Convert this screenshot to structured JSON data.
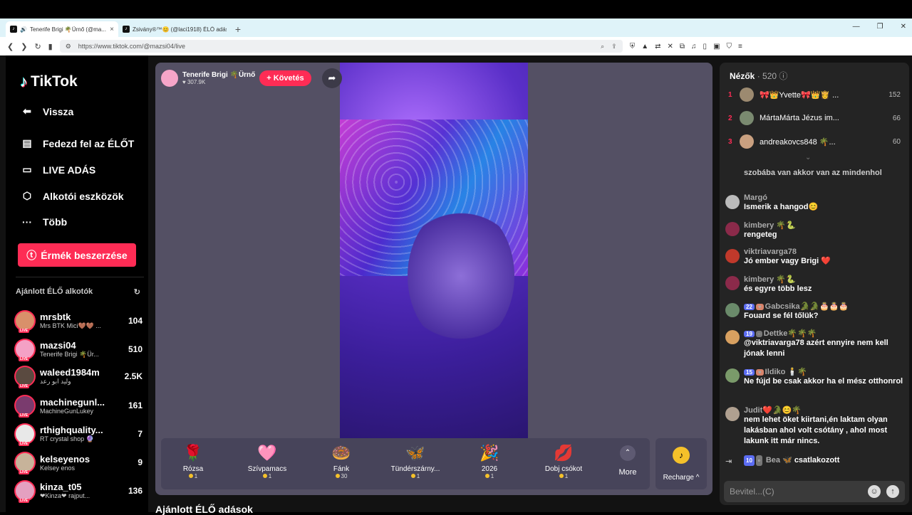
{
  "browser": {
    "tabs": [
      {
        "title": "Tenerife Brigi 🌴Ürnő (@ma..."
      },
      {
        "title": "Zsivány®™😊 (@laci1918) ÉLŐ adás..."
      }
    ],
    "url": "https://www.tiktok.com/@mazsi04/live"
  },
  "sidebar": {
    "logo": "TikTok",
    "nav": [
      {
        "label": "Vissza",
        "icon": "back-icon"
      },
      {
        "label": "Fedezd fel az ÉLŐT",
        "icon": "explore-live-icon"
      },
      {
        "label": "LIVE ADÁS",
        "icon": "live-camera-icon"
      },
      {
        "label": "Alkotói eszközök",
        "icon": "creator-tools-icon"
      },
      {
        "label": "Több",
        "icon": "more-dots-icon"
      }
    ],
    "coins_button": "Érmék beszerzése",
    "recommended_title": "Ajánlott ÉLŐ alkotók",
    "creators": [
      {
        "name": "mrsbtk",
        "sub": "Mrs BTK Mici🤎🤎 ...",
        "count": "104",
        "color": "#d9906a"
      },
      {
        "name": "mazsi04",
        "sub": "Tenerife Brigi 🌴Ür...",
        "count": "510",
        "color": "#f4a1c5"
      },
      {
        "name": "waleed1984m",
        "sub": "وليد ابو رعد",
        "count": "2.5K",
        "color": "#5a4a40"
      },
      {
        "name": "machinegunl...",
        "sub": "MachineGunLukey",
        "count": "161",
        "color": "#7a3b6e"
      },
      {
        "name": "rthighquality...",
        "sub": "RT crystal shop 🔮",
        "count": "7",
        "color": "#e8e8e8"
      },
      {
        "name": "kelseyenos",
        "sub": "Kelsey enos",
        "count": "9",
        "color": "#c7b39a"
      },
      {
        "name": "kinza_t05",
        "sub": "❤Kinza❤ rajput...",
        "count": "136",
        "color": "#e4a0c0"
      }
    ]
  },
  "stage": {
    "owner_name": "Tenerife Brigi 🌴Ürnő",
    "owner_likes": "307.9K",
    "follow_label": "+ Követés",
    "gifts": [
      {
        "name": "Rózsa",
        "price": "1",
        "icon": "🌹"
      },
      {
        "name": "Szívpamacs",
        "price": "1",
        "icon": "🩷"
      },
      {
        "name": "Fánk",
        "price": "30",
        "icon": "🍩"
      },
      {
        "name": "Tündérszárny...",
        "price": "1",
        "icon": "🦋"
      },
      {
        "name": "2026",
        "price": "1",
        "icon": "🎉"
      },
      {
        "name": "Dobj csókot",
        "price": "1",
        "icon": "💋"
      }
    ],
    "more_label": "More",
    "recharge_label": "Recharge ^"
  },
  "bottom_title": "Ajánlott ÉLŐ adások",
  "chat": {
    "viewers_label": "Nézők",
    "viewers_count": "· 520",
    "top_viewers": [
      {
        "rank": "1",
        "name": "🎀👑Yvette🎀👑👸 ...",
        "count": "152"
      },
      {
        "rank": "2",
        "name": "MártaMárta Jézus im...",
        "count": "66"
      },
      {
        "rank": "3",
        "name": "andreakovcs848 🌴...",
        "count": "60"
      }
    ],
    "messages": [
      {
        "name": "",
        "text": "szobába van akkor van az mindenhol",
        "color": "#666"
      },
      {
        "name": "Margó",
        "text": "Ismerik a hangod😊",
        "color": "#bbb"
      },
      {
        "name": "kimbery 🌴🐍",
        "text": "rengeteg",
        "color": "#8b2a4a"
      },
      {
        "name": "viktriavarga78",
        "text": "Jó ember vagy Brigi ❤️",
        "color": "#c0392b"
      },
      {
        "name": "kimbery 🌴🐍",
        "text": "és egyre több lesz",
        "color": "#8b2a4a"
      },
      {
        "name": "Gabcsika🐊🐊🎂🎂🎂",
        "badge": "22",
        "text": "Fouard se fél tőlük?",
        "color": "#6a8a6a"
      },
      {
        "name": "Dettke🌴🌴🌴",
        "badge": "19",
        "text": "@viktriavarga78 azért ennyire nem kell jónak lenni",
        "color": "#d8a060"
      },
      {
        "name": "Ildiko 🕯️🌴",
        "badge": "15",
        "text": "Ne fújd be csak akkor ha el mész otthonrol",
        "color": "#7a9a6a"
      },
      {
        "name": "Judit❤️🐊😊🌴",
        "text": "nem lehet öket kiirtani,én laktam olyan lakásban ahol volt csótány , ahol most lakunk itt már nincs.",
        "color": "#b0a090"
      },
      {
        "name": "Bea 🦋",
        "badge": "10",
        "text": "csatlakozott",
        "color": "#555"
      }
    ],
    "input_placeholder": "Bevitel...(C)"
  }
}
